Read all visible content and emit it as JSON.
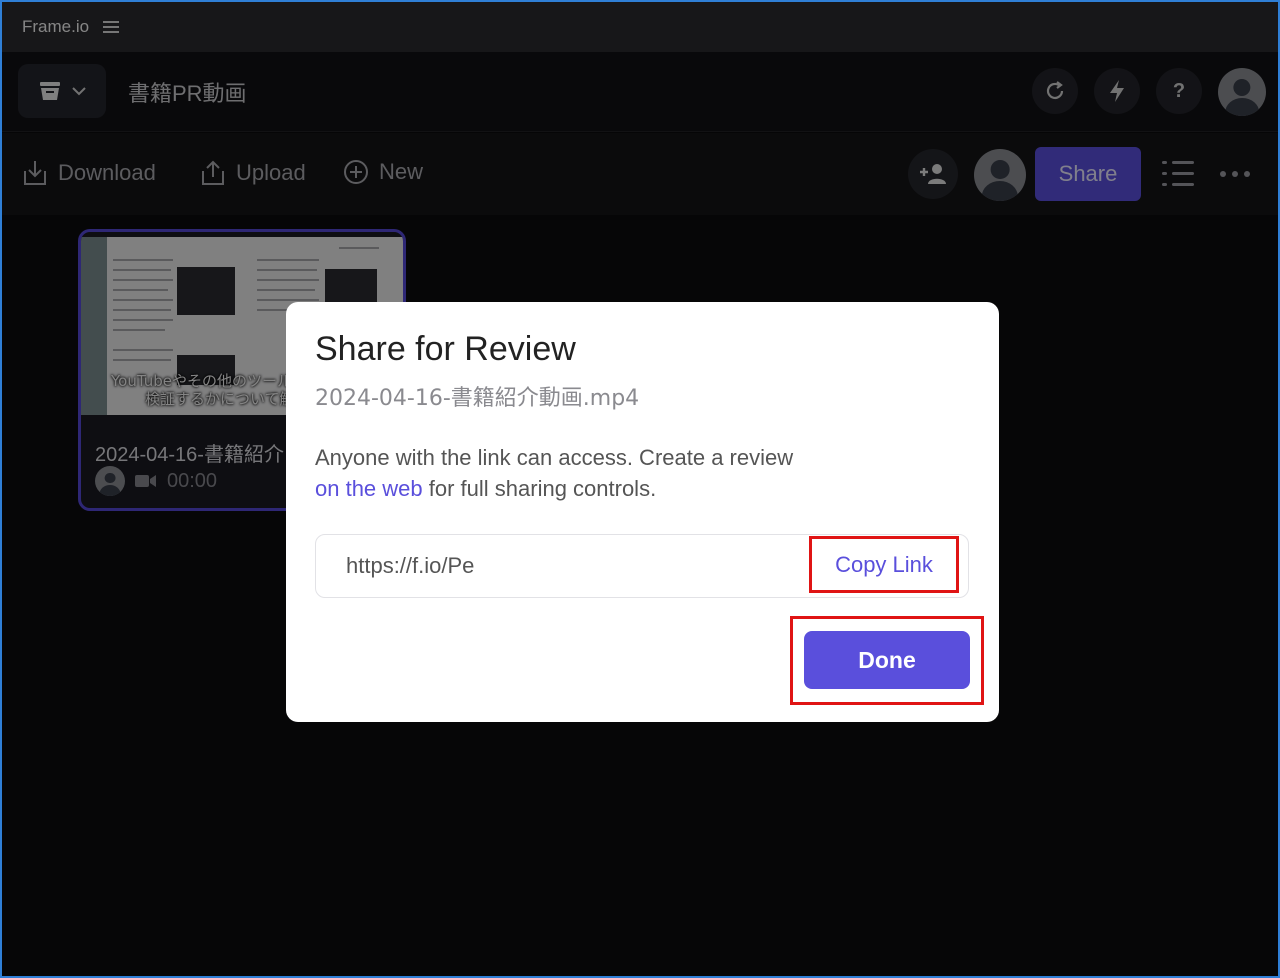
{
  "app": {
    "title": "Frame.io"
  },
  "header": {
    "project_name": "書籍PR動画"
  },
  "toolbar": {
    "download_label": "Download",
    "upload_label": "Upload",
    "new_label": "New",
    "share_label": "Share"
  },
  "asset_card": {
    "name": "2024-04-16-書籍紹介",
    "duration": "00:00",
    "thumbnail_caption_line1": "YouTubeやその他のツールを",
    "thumbnail_caption_line2": "検証するかについて触れ"
  },
  "modal": {
    "title": "Share for Review",
    "filename": "2024-04-16-書籍紹介動画.mp4",
    "description_part1": "Anyone with the link can access. Create a review",
    "description_link": "on the web",
    "description_part2": " for full sharing controls.",
    "link_value": "https://f.io/Pe",
    "copy_link_label": "Copy Link",
    "done_label": "Done"
  },
  "colors": {
    "accent": "#5a4fdc",
    "highlight_box": "#e01414",
    "window_border": "#2f7fd6"
  },
  "icons": {
    "menu": "hamburger-icon",
    "project": "inbox-tray-icon",
    "refresh": "refresh-icon",
    "bolt": "lightning-icon",
    "help": "question-icon",
    "download": "download-icon",
    "upload": "upload-icon",
    "new": "plus-circle-icon",
    "invite": "add-user-icon",
    "list": "list-view-icon",
    "more": "more-dots-icon",
    "video": "video-camera-icon"
  }
}
